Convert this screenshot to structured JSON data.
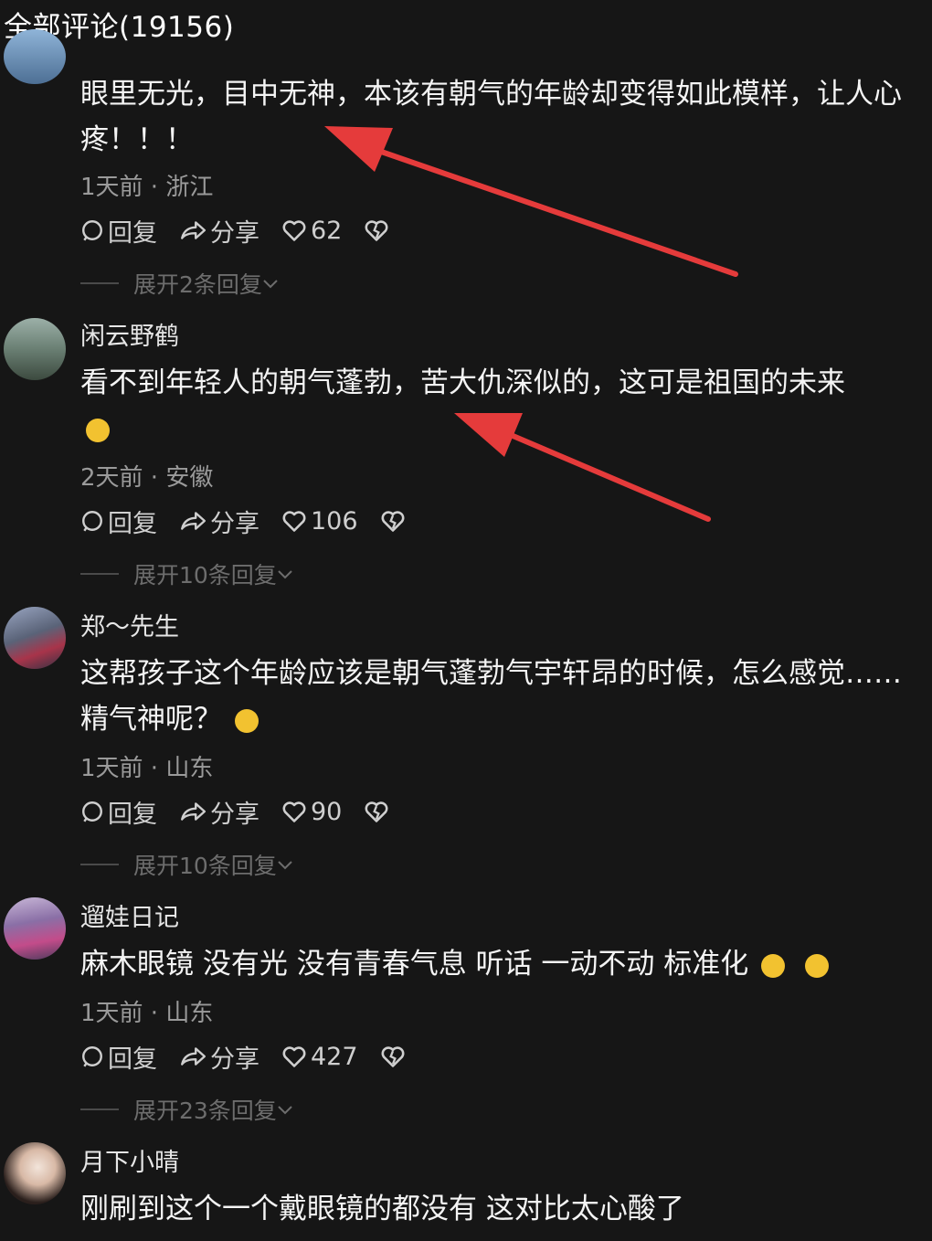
{
  "header": {
    "title": "全部评论(19156)"
  },
  "labels": {
    "reply": "回复",
    "share": "分享"
  },
  "comments": [
    {
      "username": "",
      "text": "眼里无光，目中无神，本该有朝气的年龄却变得如此模样，让人心疼！！！",
      "meta": "1天前 · 浙江",
      "likes": "62",
      "expand": "展开2条回复"
    },
    {
      "username": "闲云野鹤",
      "text": "看不到年轻人的朝气蓬勃，苦大仇深似的，这可是祖国的未来",
      "meta": "2天前 · 安徽",
      "likes": "106",
      "expand": "展开10条回复"
    },
    {
      "username": "郑～先生",
      "text": "这帮孩子这个年龄应该是朝气蓬勃气宇轩昂的时候，怎么感觉……精气神呢？",
      "meta": "1天前 · 山东",
      "likes": "90",
      "expand": "展开10条回复"
    },
    {
      "username": "遛娃日记",
      "text": "麻木眼镜 没有光 没有青春气息 听话 一动不动 标准化",
      "meta": "1天前 · 山东",
      "likes": "427",
      "expand": "展开23条回复"
    },
    {
      "username": "月下小晴",
      "text": "刚刷到这个一个戴眼镜的都没有 这对比太心酸了",
      "meta": "",
      "likes": "",
      "expand": ""
    }
  ],
  "colors": {
    "background": "#161616",
    "arrow": "#e53b3b",
    "emoji": "#f2c230"
  },
  "icons": [
    "comment-icon",
    "share-icon",
    "heart-icon",
    "dislike-icon",
    "chevron-down-icon"
  ]
}
